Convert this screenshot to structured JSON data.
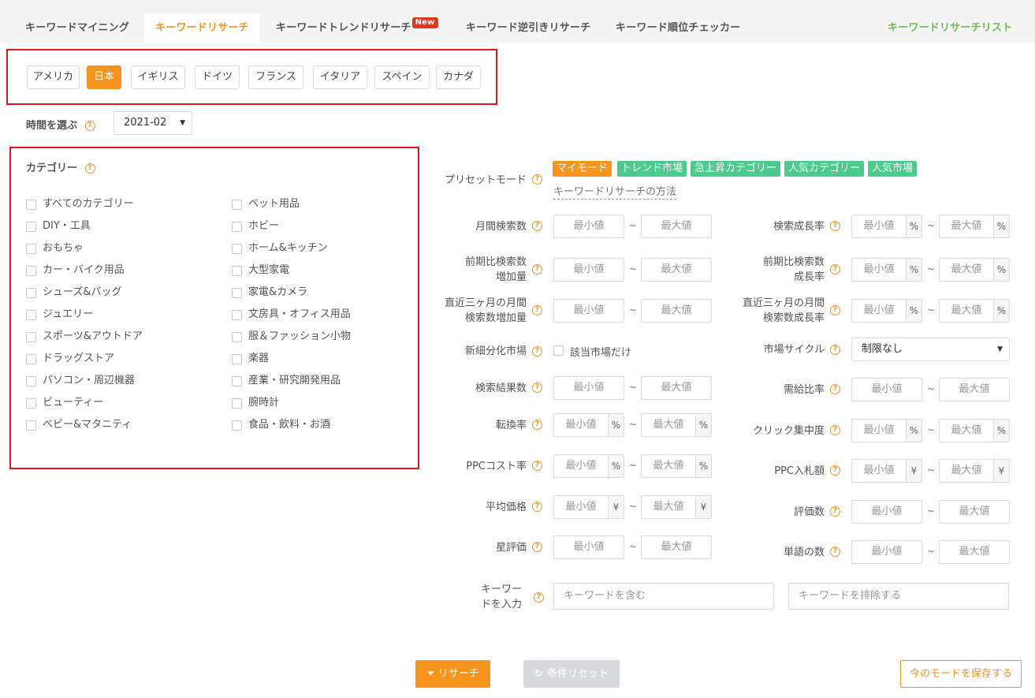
{
  "tabs": [
    {
      "label": "キーワードマイニング"
    },
    {
      "label": "キーワードリサーチ"
    },
    {
      "label": "キーワードトレンドリサーチ",
      "badge": "New"
    },
    {
      "label": "キーワード逆引きリサーチ"
    },
    {
      "label": "キーワード順位チェッカー"
    },
    {
      "label": "キーワードリサーチリスト"
    }
  ],
  "countries": [
    "アメリカ",
    "日本",
    "イギリス",
    "ドイツ",
    "フランス",
    "イタリア",
    "スペイン",
    "カナダ"
  ],
  "selected_country": "日本",
  "time": {
    "label": "時間を選ぶ",
    "value": "2021-02"
  },
  "category": {
    "title": "カテゴリー",
    "left": [
      "すべてのカテゴリー",
      "DIY・工具",
      "おもちゃ",
      "カー・バイク用品",
      "シューズ&バッグ",
      "ジュエリー",
      "スポーツ&アウトドア",
      "ドラッグストア",
      "パソコン・周辺機器",
      "ビューティー",
      "ベビー&マタニティ"
    ],
    "right": [
      "ペット用品",
      "ホビー",
      "ホーム&キッチン",
      "大型家電",
      "家電&カメラ",
      "文房具・オフィス用品",
      "服＆ファッション小物",
      "楽器",
      "産業・研究開発用品",
      "腕時計",
      "食品・飲料・お酒"
    ]
  },
  "preset": {
    "label": "プリセットモード",
    "tags": [
      "マイモード",
      "トレンド市場",
      "急上昇カテゴリー",
      "人気カテゴリー",
      "人気市場"
    ],
    "method_link": "キーワードリサーチの方法"
  },
  "placeholders": {
    "min": "最小値",
    "max": "最大値"
  },
  "units": {
    "percent": "%",
    "yen": "¥",
    "tilde": "~"
  },
  "filters": {
    "monthly_search": "月間検索数",
    "search_growth": "検索成長率",
    "prev_increase_1": "前期比検索数",
    "prev_increase_2": "増加量",
    "prev_growth_1": "前期比検索数",
    "prev_growth_2": "成長率",
    "recent3_increase_1": "直近三ヶ月の月間",
    "recent3_increase_2": "検索数増加量",
    "recent3_growth_1": "直近三ヶ月の月間",
    "recent3_growth_2": "検索数成長率",
    "new_segment": "新細分化市場",
    "new_segment_check": "該当市場だけ",
    "market_cycle": "市場サイクル",
    "market_cycle_value": "制限なし",
    "search_results": "検索結果数",
    "demand_ratio": "需給比率",
    "conversion": "転換率",
    "click_concentration": "クリック集中度",
    "ppc_cost": "PPCコスト率",
    "ppc_bid": "PPC入札額",
    "avg_price": "平均価格",
    "review_count": "評価数",
    "star_rating": "星評価",
    "word_count": "単語の数",
    "keyword_1": "キーワー",
    "keyword_2": "ドを入力",
    "keyword_include": "キーワードを含む",
    "keyword_exclude": "キーワードを排除する"
  },
  "buttons": {
    "research": "リサーチ",
    "reset": "条件リセット",
    "save_mode": "今のモードを保存する"
  },
  "colors": {
    "accent": "#f7941d",
    "tag_green": "#4ccb8f",
    "highlight_red": "#e3141b",
    "list_green": "#6dbf4b"
  }
}
